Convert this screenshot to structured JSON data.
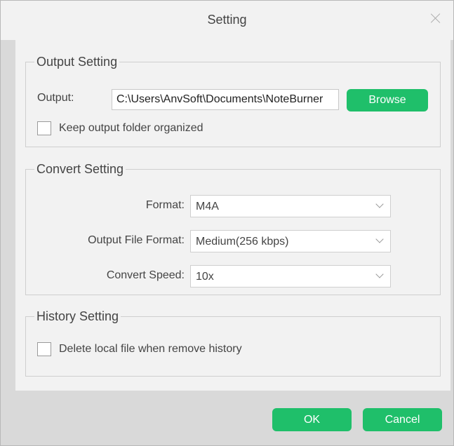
{
  "window": {
    "title": "Setting"
  },
  "output_setting": {
    "legend": "Output Setting",
    "output_label": "Output:",
    "output_path": "C:\\Users\\AnvSoft\\Documents\\NoteBurner",
    "browse_label": "Browse",
    "keep_organized_label": "Keep output folder organized",
    "keep_organized_checked": false
  },
  "convert_setting": {
    "legend": "Convert Setting",
    "format_label": "Format:",
    "format_value": "M4A",
    "output_file_format_label": "Output File Format:",
    "output_file_format_value": "Medium(256 kbps)",
    "convert_speed_label": "Convert Speed:",
    "convert_speed_value": "10x"
  },
  "history_setting": {
    "legend": "History Setting",
    "delete_local_label": "Delete local file when remove history",
    "delete_local_checked": false
  },
  "footer": {
    "ok_label": "OK",
    "cancel_label": "Cancel"
  },
  "colors": {
    "accent_green": "#1fbf6a",
    "panel_bg": "#f2f2f2",
    "frame_bg": "#d9d9d9"
  }
}
